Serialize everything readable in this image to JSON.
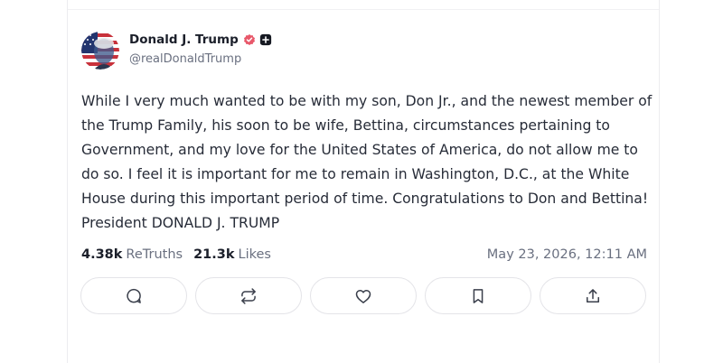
{
  "post": {
    "author": {
      "display_name": "Donald J. Trump",
      "handle": "@realDonaldTrump",
      "badges": [
        "verified-badge-icon",
        "plus-badge-icon"
      ]
    },
    "text": "While I very much wanted to be with my son, Don Jr., and the newest member of the Trump Family, his soon to be wife, Bettina, circumstances pertaining to Government, and my love for the United States of America, do not allow me to do so. I feel it is important for me to remain in Washington, D.C., at the White House during this important period of time. Congratulations to Don and Bettina! President DONALD J. TRUMP",
    "stats": {
      "retruths_count": "4.38k",
      "retruths_label": "ReTruths",
      "likes_count": "21.3k",
      "likes_label": "Likes"
    },
    "timestamp": "May 23, 2026, 12:11 AM"
  },
  "actions": [
    "reply-icon",
    "retruth-icon",
    "like-icon",
    "bookmark-icon",
    "share-icon"
  ],
  "colors": {
    "verified_badge": "#e8586a",
    "plus_badge": "#161922",
    "text": "#272c38",
    "muted": "#6a7080",
    "border": "#e4e4e8"
  }
}
